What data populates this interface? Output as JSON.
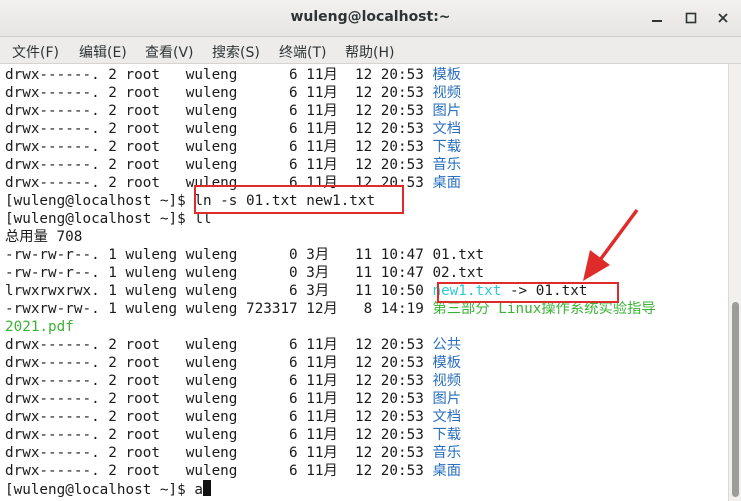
{
  "window": {
    "title": "wuleng@localhost:~",
    "buttons": {
      "minimize": "minimize-icon",
      "maximize": "maximize-icon",
      "close": "close-icon"
    }
  },
  "menu": [
    "文件(F)",
    "编辑(E)",
    "查看(V)",
    "搜索(S)",
    "终端(T)",
    "帮助(H)"
  ],
  "terminal": {
    "lines": [
      [
        {
          "t": "drwx------. 2 root   wuleng      6 11月  12 20:53 "
        },
        {
          "t": "模板",
          "c": "blue"
        }
      ],
      [
        {
          "t": "drwx------. 2 root   wuleng      6 11月  12 20:53 "
        },
        {
          "t": "视频",
          "c": "blue"
        }
      ],
      [
        {
          "t": "drwx------. 2 root   wuleng      6 11月  12 20:53 "
        },
        {
          "t": "图片",
          "c": "blue"
        }
      ],
      [
        {
          "t": "drwx------. 2 root   wuleng      6 11月  12 20:53 "
        },
        {
          "t": "文档",
          "c": "blue"
        }
      ],
      [
        {
          "t": "drwx------. 2 root   wuleng      6 11月  12 20:53 "
        },
        {
          "t": "下载",
          "c": "blue"
        }
      ],
      [
        {
          "t": "drwx------. 2 root   wuleng      6 11月  12 20:53 "
        },
        {
          "t": "音乐",
          "c": "blue"
        }
      ],
      [
        {
          "t": "drwx------. 2 root   wuleng      6 11月  12 20:53 "
        },
        {
          "t": "桌面",
          "c": "blue"
        }
      ],
      [
        {
          "t": "[wuleng@localhost ~]$ ln -s 01.txt new1.txt"
        }
      ],
      [
        {
          "t": "[wuleng@localhost ~]$ ll"
        }
      ],
      [
        {
          "t": "总用量 708"
        }
      ],
      [
        {
          "t": "-rw-rw-r--. 1 wuleng wuleng      0 3月   11 10:47 01.txt"
        }
      ],
      [
        {
          "t": "-rw-rw-r--. 1 wuleng wuleng      0 3月   11 10:47 02.txt"
        }
      ],
      [
        {
          "t": "lrwxrwxrwx. 1 wuleng wuleng      6 3月   11 10:50 "
        },
        {
          "t": "new1.txt",
          "c": "cyan"
        },
        {
          "t": " -> 01.txt"
        }
      ],
      [
        {
          "t": "-rwxrw-rw-. 1 wuleng wuleng 723317 12月   8 14:19 "
        },
        {
          "t": "第三部分 Linux操作系统实验指导",
          "c": "green"
        }
      ],
      [
        {
          "t": "2021.pdf",
          "c": "green"
        }
      ],
      [
        {
          "t": "drwx------. 2 root   wuleng      6 11月  12 20:53 "
        },
        {
          "t": "公共",
          "c": "blue"
        }
      ],
      [
        {
          "t": "drwx------. 2 root   wuleng      6 11月  12 20:53 "
        },
        {
          "t": "模板",
          "c": "blue"
        }
      ],
      [
        {
          "t": "drwx------. 2 root   wuleng      6 11月  12 20:53 "
        },
        {
          "t": "视频",
          "c": "blue"
        }
      ],
      [
        {
          "t": "drwx------. 2 root   wuleng      6 11月  12 20:53 "
        },
        {
          "t": "图片",
          "c": "blue"
        }
      ],
      [
        {
          "t": "drwx------. 2 root   wuleng      6 11月  12 20:53 "
        },
        {
          "t": "文档",
          "c": "blue"
        }
      ],
      [
        {
          "t": "drwx------. 2 root   wuleng      6 11月  12 20:53 "
        },
        {
          "t": "下载",
          "c": "blue"
        }
      ],
      [
        {
          "t": "drwx------. 2 root   wuleng      6 11月  12 20:53 "
        },
        {
          "t": "音乐",
          "c": "blue"
        }
      ],
      [
        {
          "t": "drwx------. 2 root   wuleng      6 11月  12 20:53 "
        },
        {
          "t": "桌面",
          "c": "blue"
        }
      ],
      [
        {
          "t": "[wuleng@localhost ~]$ a"
        },
        {
          "cursor": true
        }
      ]
    ]
  },
  "colors": {
    "directory": "#2a6fc0",
    "symlink": "#2ec9d8",
    "executable": "#3bb336",
    "annotation": "#e02b2b"
  },
  "annotations": {
    "highlight_boxes": 2,
    "arrow": "red-arrow-icon"
  }
}
